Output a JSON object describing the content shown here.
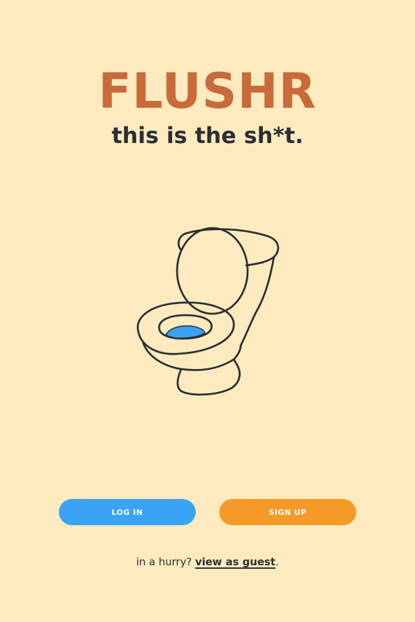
{
  "app": {
    "name": "FLUSHR",
    "tagline": "this is the sh*t."
  },
  "illustration": {
    "icon": "toilet-icon"
  },
  "buttons": {
    "login_label": "LOG IN",
    "signup_label": "SIGN UP"
  },
  "guest": {
    "prefix": "in a hurry? ",
    "link_label": "view as guest",
    "suffix": "."
  },
  "colors": {
    "background": "#FDEBBF",
    "brand": "#C96A3A",
    "text": "#2B2F33",
    "login_button": "#3BA3F5",
    "signup_button": "#F59A28",
    "water": "#3AA2F0"
  }
}
